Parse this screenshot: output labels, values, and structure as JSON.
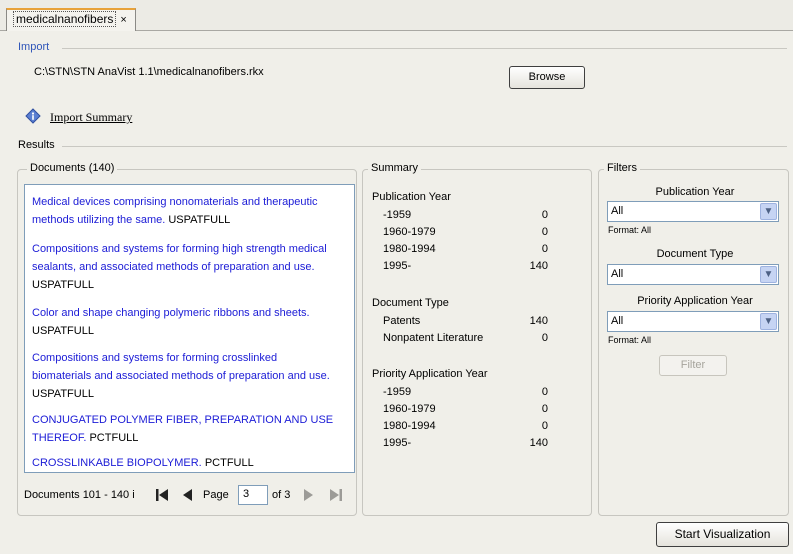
{
  "tab": {
    "label": "medicalnanofibers",
    "close": "×"
  },
  "import": {
    "title": "Import",
    "path": "C:\\STN\\STN AnaVist 1.1\\medicalnanofibers.rkx",
    "browse_label": "Browse",
    "summary_link": "Import Summary",
    "info_icon": "info-icon"
  },
  "results": {
    "title": "Results"
  },
  "documents": {
    "title": "Documents (140)",
    "items": [
      {
        "title": "Medical devices comprising nonomaterials and therapeutic methods utilizing the same.",
        "source": "USPATFULL"
      },
      {
        "title": "Compositions and systems for forming high strength medical sealants, and associated methods of preparation and use.",
        "source": "USPATFULL"
      },
      {
        "title": "Color and shape changing polymeric ribbons and sheets.",
        "source": "USPATFULL"
      },
      {
        "title": "Compositions and systems for forming crosslinked biomaterials and associated methods of preparation and use.",
        "source": "USPATFULL"
      },
      {
        "title": "CONJUGATED POLYMER FIBER, PREPARATION AND USE THEREOF.",
        "source": "PCTFULL"
      },
      {
        "title": "CROSSLINKABLE BIOPOLYMER.",
        "source": "PCTFULL"
      }
    ],
    "range_label": "Documents 101 - 140 i",
    "page_label": "Page",
    "page_value": "3",
    "of_label": "of 3"
  },
  "summary": {
    "title": "Summary",
    "groups": [
      {
        "heading": "Publication Year",
        "rows": [
          {
            "label": "-1959",
            "value": "0"
          },
          {
            "label": "1960-1979",
            "value": "0"
          },
          {
            "label": "1980-1994",
            "value": "0"
          },
          {
            "label": "1995-",
            "value": "140"
          }
        ]
      },
      {
        "heading": "Document Type",
        "rows": [
          {
            "label": "Patents",
            "value": "140"
          },
          {
            "label": "Nonpatent Literature",
            "value": "0"
          }
        ]
      },
      {
        "heading": "Priority Application Year",
        "rows": [
          {
            "label": "-1959",
            "value": "0"
          },
          {
            "label": "1960-1979",
            "value": "0"
          },
          {
            "label": "1980-1994",
            "value": "0"
          },
          {
            "label": "1995-",
            "value": "140"
          }
        ]
      }
    ]
  },
  "filters": {
    "title": "Filters",
    "pub_year": {
      "label": "Publication Year",
      "value": "All",
      "format": "Format: All"
    },
    "doc_type": {
      "label": "Document Type",
      "value": "All"
    },
    "prio_year": {
      "label": "Priority Application Year",
      "value": "All",
      "format": "Format: All"
    },
    "filter_button": "Filter"
  },
  "start_button": "Start Visualization"
}
